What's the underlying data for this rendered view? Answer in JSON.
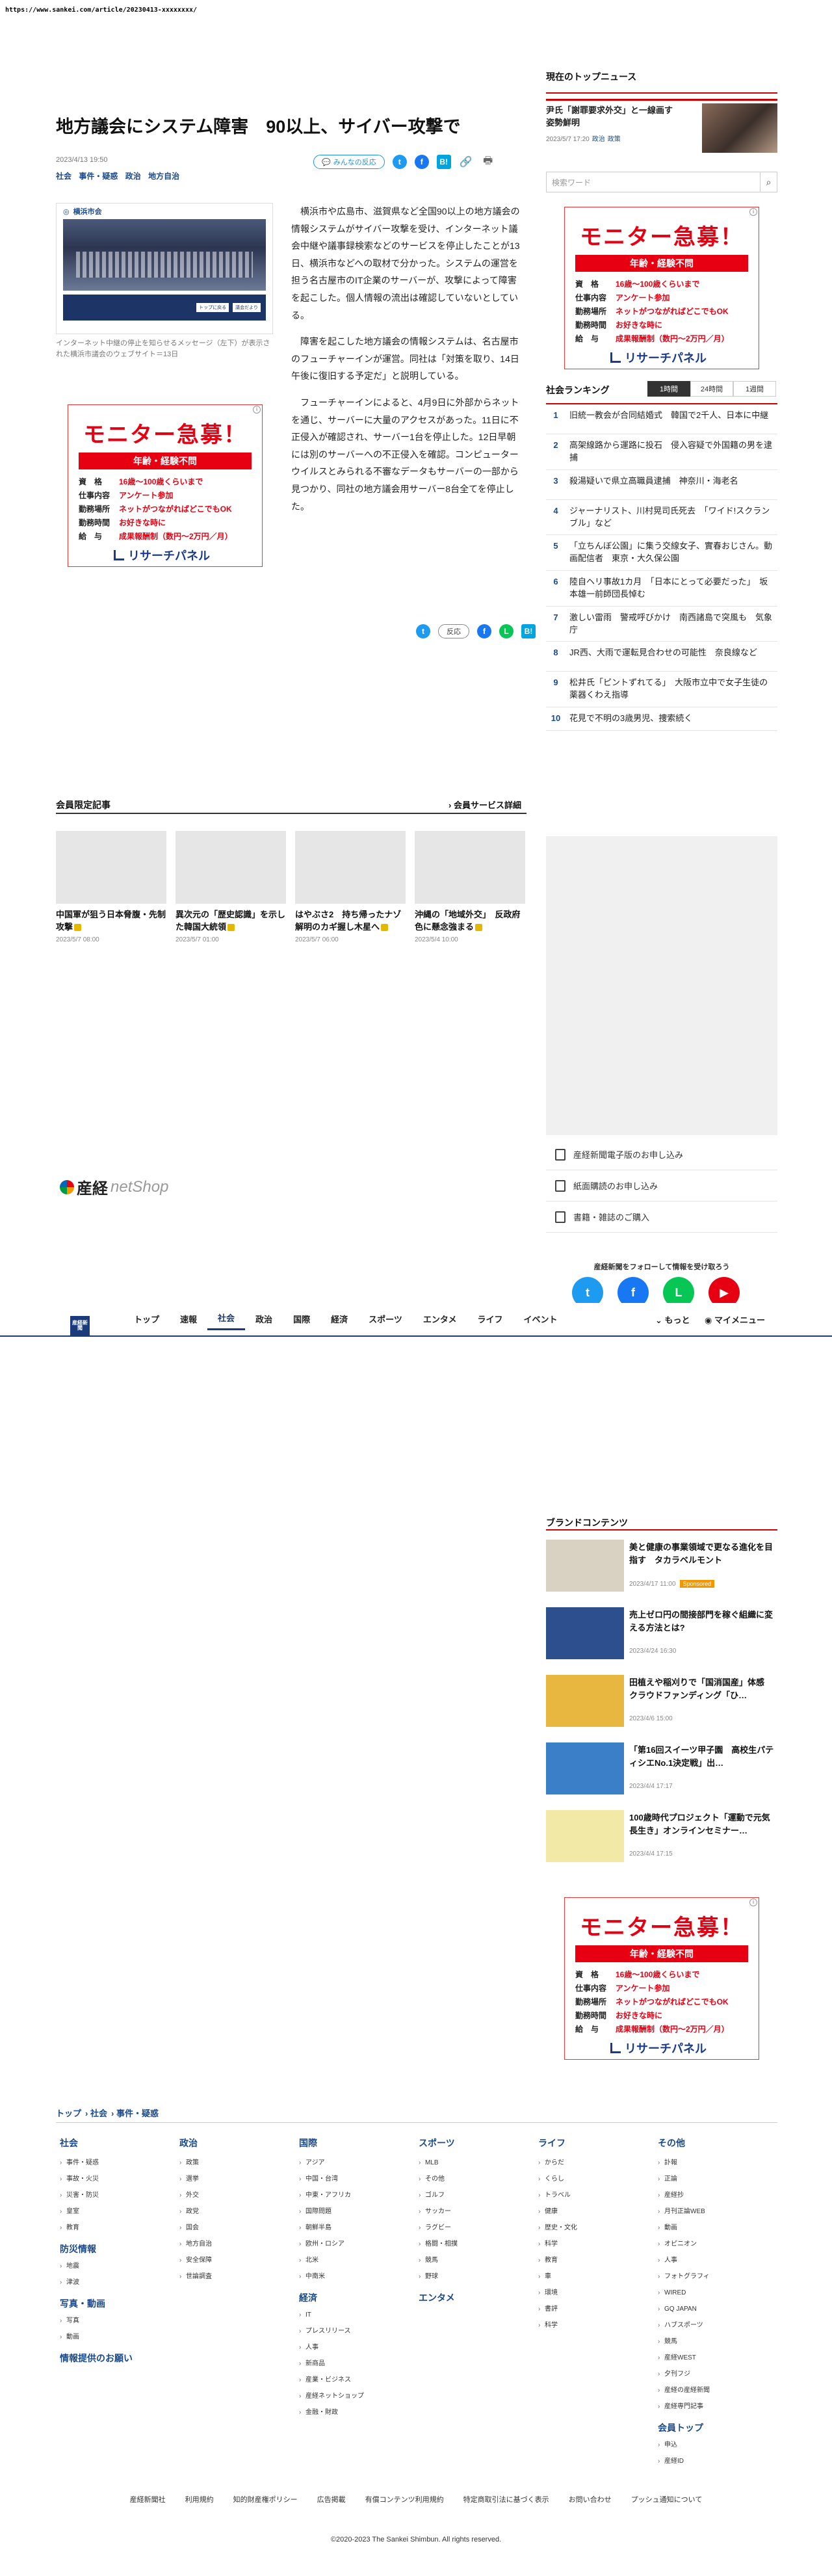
{
  "url": "https://www.sankei.com/article/20230413-xxxxxxxx/",
  "article": {
    "title": "地方議会にシステム障害　90以上、サイバー攻撃で",
    "date": "2023/4/13 19:50",
    "categories": [
      "社会",
      "事件・疑惑",
      "政治",
      "地方自治"
    ],
    "reaction_label": "みんなの反応",
    "reaction_label_short": "反応",
    "photo_site": "横浜市会",
    "photo_btn1": "トップに戻る",
    "photo_btn2": "議会だより",
    "caption": "インターネット中継の停止を知らせるメッセージ（左下）が表示された横浜市議会のウェブサイト＝13日",
    "paragraphs": [
      "横浜市や広島市、滋賀県など全国90以上の地方議会の情報システムがサイバー攻撃を受け、インターネット議会中継や議事録検索などのサービスを停止したことが13日、横浜市などへの取材で分かった。システムの運営を担う名古屋市のIT企業のサーバーが、攻撃によって障害を起こした。個人情報の流出は確認していないとしている。",
      "障害を起こした地方議会の情報システムは、名古屋市のフューチャーインが運営。同社は「対策を取り、14日午後に復旧する予定だ」と説明している。",
      "フューチャーインによると、4月9日に外部からネットを通じ、サーバーに大量のアクセスがあった。11日に不正侵入が確認され、サーバー1台を停止した。12日早朝には別のサーバーへの不正侵入を確認。コンピューターウイルスとみられる不審なデータもサーバーの一部から見つかり、同社の地方議会用サーバー8台全てを停止した。"
    ]
  },
  "ad": {
    "title": "モニター急募！",
    "sub": "年齢・経験不問",
    "rows": [
      {
        "k": "資　格",
        "v": "16歳～100歳くらいまで"
      },
      {
        "k": "仕事内容",
        "v": "アンケート参加"
      },
      {
        "k": "勤務場所",
        "v": "ネットがつながればどこでもOK"
      },
      {
        "k": "勤務時間",
        "v": "お好きな時に"
      },
      {
        "k": "給　与",
        "v": "成果報酬制（数円～2万円／月）"
      }
    ],
    "logo": "リサーチパネル",
    "info": "i"
  },
  "sidebar": {
    "top_news_heading": "現在のトップニュース",
    "top_news": {
      "title": "尹氏「謝罪要求外交」と一線画す　姿勢鮮明",
      "date": "2023/5/7 17:20",
      "cats": [
        "政治",
        "政策"
      ]
    },
    "search_placeholder": "検索ワード",
    "ranking_heading": "社会ランキング",
    "ranking_tabs": [
      "1時間",
      "24時間",
      "1週間"
    ],
    "ranking": [
      {
        "n": "1",
        "t": "旧統一教会が合同結婚式　韓国で2千人、日本に中継"
      },
      {
        "n": "2",
        "t": "高架線路から運路に投石　侵入容疑で外国籍の男を逮捕"
      },
      {
        "n": "3",
        "t": "殺湯疑いで県立高職員逮捕　神奈川・海老名"
      },
      {
        "n": "4",
        "t": "ジャーナリスト、川村晃司氏死去　「ワイド!スクランブル」など"
      },
      {
        "n": "5",
        "t": "「立ちんぼ公園」に集う交線女子、實春おじさん。動画配信者　東京・大久保公園"
      },
      {
        "n": "6",
        "t": "陸自ヘリ事故1カ月　「日本にとって必要だった」　坂本雄一前師団長悼む"
      },
      {
        "n": "7",
        "t": "激しい雷雨　警戒呼びかけ　南西諸島で突風も　気象庁"
      },
      {
        "n": "8",
        "t": "JR西、大雨で運転見合わせの可能性　奈良線など"
      },
      {
        "n": "9",
        "t": "松井氏「ピントずれてる」　大阪市立中で女子生徒の薬器くわえ指導"
      },
      {
        "n": "10",
        "t": "花見で不明の3歳男児、捜索続く"
      }
    ],
    "links": [
      "産経新聞電子版のお申し込み",
      "紙面購読のお申し込み",
      "書籍・雑誌のご購入"
    ],
    "follow_heading": "産経新聞をフォローして情報を受け取ろう",
    "brand_heading": "ブランドコンテンツ",
    "brand": [
      {
        "t": "美と健康の事業領域で更なる進化を目指す　タカラベルモント",
        "d": "2023/4/17 11:00",
        "sp": "Sponsored",
        "color": "#d9d2c3"
      },
      {
        "t": "売上ゼロ円の間接部門を稼ぐ組織に変える方法とは?",
        "d": "2023/4/24 16:30",
        "sp": "",
        "color": "#2d4f8e"
      },
      {
        "t": "田植えや稲刈りで「国消国産」体感　クラウドファンディング「ひ…",
        "d": "2023/4/6 15:00",
        "sp": "",
        "color": "#e8b73f"
      },
      {
        "t": "「第16回スイーツ甲子園　高校生パティシエNo.1決定戦」出…",
        "d": "2023/4/4 17:17",
        "sp": "",
        "color": "#3c7fc9"
      },
      {
        "t": "100歳時代プロジェクト「運動で元気長生き」オンラインセミナー…",
        "d": "2023/4/4 17:15",
        "sp": "",
        "color": "#f2e9a6"
      }
    ]
  },
  "members": {
    "heading": "会員限定記事",
    "more": "会員サービス詳細",
    "items": [
      {
        "t": "中国軍が狙う日本脅腹・先制攻撃",
        "d": "2023/5/7 08:00"
      },
      {
        "t": "異次元の「歴史認識」を示した韓国大統領",
        "d": "2023/5/7 01:00"
      },
      {
        "t": "はやぶさ2　持ち帰ったナゾ　解明のカギ握し木星へ",
        "d": "2023/5/7 06:00"
      },
      {
        "t": "沖縄の「地域外交」　反政府色に懸念強まる",
        "d": "2023/5/4 10:00"
      }
    ]
  },
  "shop_logo": {
    "brand": "産経",
    "suffix": "netShop"
  },
  "nav": {
    "logo": "産経新聞",
    "items": [
      "トップ",
      "速報",
      "社会",
      "政治",
      "国際",
      "経済",
      "スポーツ",
      "エンタメ",
      "ライフ",
      "イベント"
    ],
    "active": "社会",
    "more": "もっと",
    "my": "マイメニュー"
  },
  "footer": {
    "crumbs": [
      "トップ",
      "社会",
      "事件・疑惑"
    ],
    "cols": [
      {
        "h": "社会",
        "items": [
          "事件・疑惑",
          "事故・火災",
          "災害・防災",
          "皇室",
          "教育"
        ],
        "h2": "防災情報",
        "items2": [
          "地震",
          "津波"
        ],
        "h3": "写真・動画",
        "items3": [
          "写真",
          "動画"
        ],
        "h4": "情報提供のお願い"
      },
      {
        "h": "政治",
        "items": [
          "政策",
          "選挙",
          "外交",
          "政党",
          "国会",
          "地方自治",
          "安全保障",
          "世論調査"
        ]
      },
      {
        "h": "国際",
        "items": [
          "アジア",
          "中国・台湾",
          "中東・アフリカ",
          "国際問題",
          "朝鮮半島",
          "欧州・ロシア",
          "北米",
          "中南米"
        ],
        "h2": "経済",
        "items2": [
          "IT",
          "プレスリリース",
          "人事",
          "新商品",
          "産業・ビジネス",
          "産経ネットショップ",
          "金融・財政"
        ]
      },
      {
        "h": "スポーツ",
        "items": [
          "MLB",
          "その他",
          "ゴルフ",
          "サッカー",
          "ラグビー",
          "格闘・相撲",
          "競馬",
          "野球"
        ],
        "h2": "エンタメ"
      },
      {
        "h": "ライフ",
        "items": [
          "からだ",
          "くらし",
          "トラベル",
          "健康",
          "歴史・文化",
          "科学",
          "教育",
          "車",
          "環境",
          "書評",
          "科学"
        ]
      },
      {
        "h": "その他",
        "items": [
          "訃報",
          "正論",
          "産経抄",
          "月刊正論WEB",
          "動画",
          "オピニオン",
          "人事",
          "フォトグラフィ",
          "WIRED",
          "GQ JAPAN",
          "ハブスポーツ",
          "競馬",
          "産経WEST",
          "夕刊フジ",
          "産経の産経新聞",
          "産経専門記事"
        ],
        "h2": "会員トップ",
        "items2": [
          "申込",
          "産経ID"
        ]
      }
    ],
    "bottom_links": [
      "産経新聞社",
      "利用規約",
      "知的財産権ポリシー",
      "広告掲載",
      "有償コンテンツ利用規約",
      "特定商取引法に基づく表示",
      "お問い合わせ",
      "プッシュ通知について"
    ],
    "copyright": "©2020-2023 The Sankei Shimbun. All rights reserved."
  }
}
